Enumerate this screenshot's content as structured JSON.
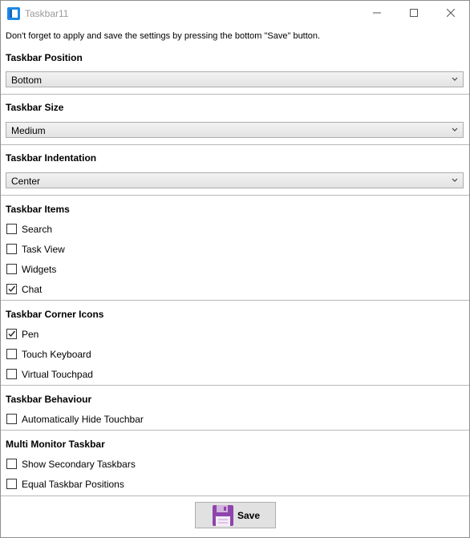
{
  "window": {
    "title": "Taskbar11",
    "minimize": "minimize-icon",
    "maximize": "maximize-icon",
    "close": "close-icon",
    "app_icon": "taskbar-app-icon"
  },
  "hint": "Don't forget to apply and save the settings by pressing the bottom \"Save\" button.",
  "position": {
    "title": "Taskbar Position",
    "value": "Bottom"
  },
  "size": {
    "title": "Taskbar Size",
    "value": "Medium"
  },
  "indentation": {
    "title": "Taskbar Indentation",
    "value": "Center"
  },
  "items": {
    "title": "Taskbar Items",
    "search": {
      "label": "Search",
      "checked": false
    },
    "taskview": {
      "label": "Task View",
      "checked": false
    },
    "widgets": {
      "label": "Widgets",
      "checked": false
    },
    "chat": {
      "label": "Chat",
      "checked": true
    }
  },
  "corner": {
    "title": "Taskbar Corner Icons",
    "pen": {
      "label": "Pen",
      "checked": true
    },
    "touchkeyboard": {
      "label": "Touch Keyboard",
      "checked": false
    },
    "touchpad": {
      "label": "Virtual Touchpad",
      "checked": false
    }
  },
  "behaviour": {
    "title": "Taskbar Behaviour",
    "autohide": {
      "label": "Automatically Hide Touchbar",
      "checked": false
    }
  },
  "multimonitor": {
    "title": "Multi Monitor Taskbar",
    "secondary": {
      "label": "Show Secondary Taskbars",
      "checked": false
    },
    "equal": {
      "label": "Equal Taskbar Positions",
      "checked": false
    }
  },
  "save": {
    "label": "Save",
    "icon": "floppy-disk-icon"
  }
}
